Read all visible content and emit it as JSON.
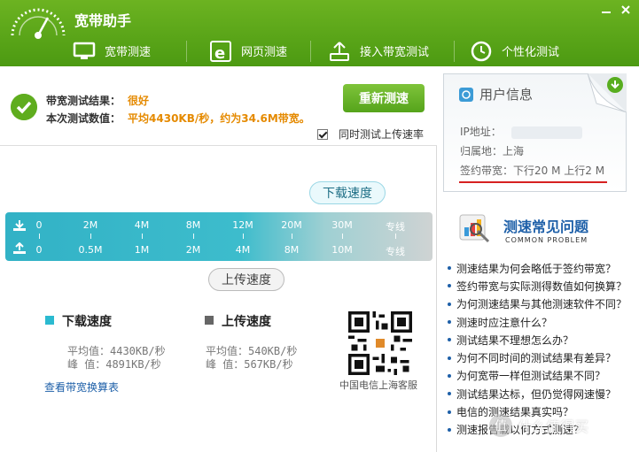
{
  "header": {
    "title": "宽带助手",
    "tabs": [
      {
        "label": "宽带测速",
        "icon": "monitor-icon"
      },
      {
        "label": "网页测速",
        "icon": "browser-e-icon"
      },
      {
        "label": "接入带宽测试",
        "icon": "network-upload-icon"
      },
      {
        "label": "个性化测试",
        "icon": "clock-icon"
      }
    ]
  },
  "result": {
    "label1": "带宽测试结果：",
    "value1": "很好",
    "label2": "本次测试数值：",
    "value2": "平均4430KB/秒，约为34.6M带宽。",
    "retest_label": "重新测速",
    "upload_checkbox_label": "同时测试上传速率",
    "upload_checkbox_checked": true
  },
  "gauge": {
    "download_bubble": "下载速度",
    "upload_bubble": "上传速度",
    "download_ticks": [
      "0",
      "2M",
      "4M",
      "8M",
      "12M",
      "20M",
      "30M",
      "专线"
    ],
    "upload_ticks": [
      "0",
      "0.5M",
      "1M",
      "2M",
      "4M",
      "8M",
      "10M",
      "专线"
    ]
  },
  "stats": {
    "download": {
      "title": "下载速度",
      "avg": "平均值：4430KB/秒",
      "peak": "峰 值：4891KB/秒",
      "color": "#2bbad0"
    },
    "upload": {
      "title": "上传速度",
      "avg": "平均值：540KB/秒",
      "peak": "峰 值：567KB/秒",
      "color": "#666666"
    },
    "link": "查看带宽换算表",
    "qr_caption": "中国电信上海客服"
  },
  "user_info": {
    "title": "用户信息",
    "ip_label": "IP地址：",
    "location": "归属地：上海",
    "bandwidth": "签约带宽：下行20 M 上行2 M"
  },
  "faq": {
    "title": "测速常见问题",
    "subtitle": "COMMON PROBLEM",
    "items": [
      "测速结果为何会略低于签约带宽？",
      "签约带宽与实际测得数值如何换算？",
      "为何测速结果与其他测速软件不同？",
      "测速时应注意什么？",
      "测试结果不理想怎么办？",
      "为何不同时间的测试结果有差异？",
      "为何宽带一样但测试结果不同？",
      "测试结果达标，但仍觉得网速慢？",
      "电信的测速结果真实吗？",
      "测速报告载以何方式测速？"
    ]
  },
  "watermark": {
    "badge": "值",
    "text": "什么值得买"
  }
}
